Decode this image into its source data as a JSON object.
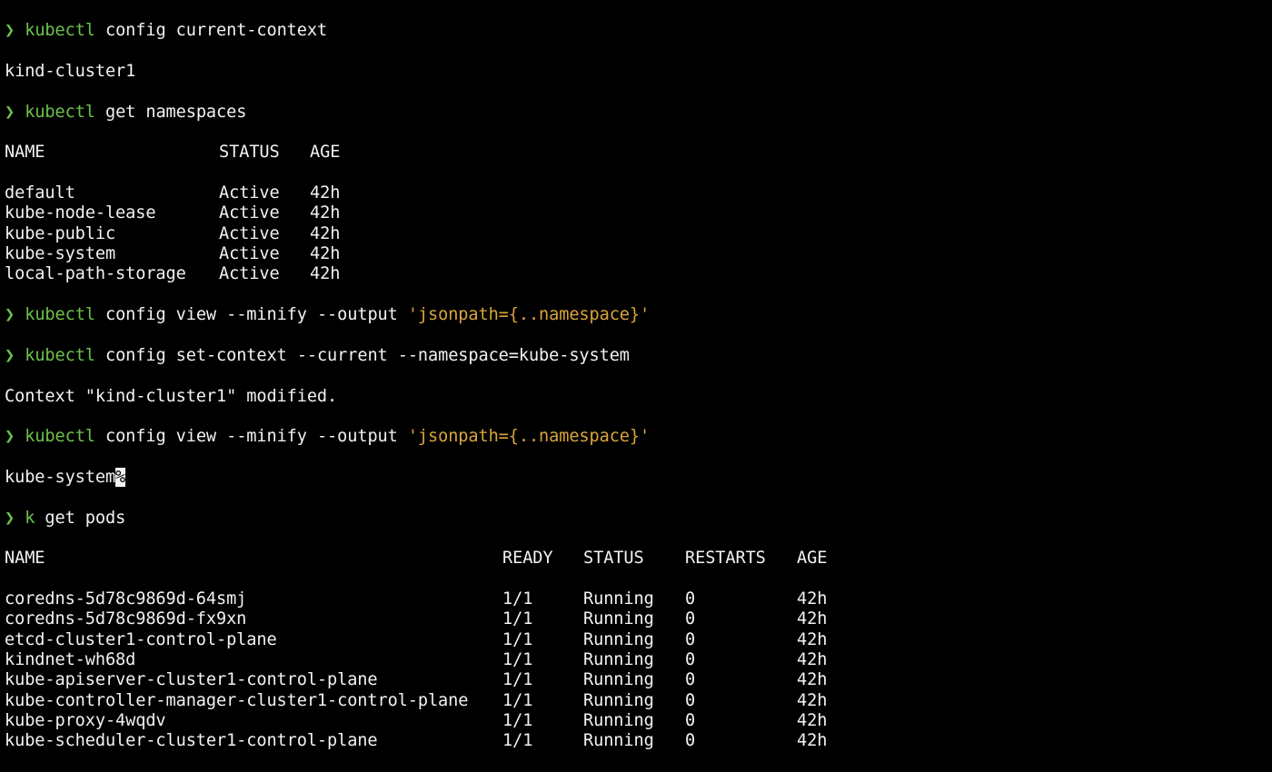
{
  "colors": {
    "background": "#000000",
    "text": "#f2f2f2",
    "command": "#6cc24a",
    "string": "#d9a53c"
  },
  "prompt_icon": "chevron-right-icon",
  "prompt_glyph": "❯",
  "lines": {
    "l1": {
      "cmd": "kubectl",
      "args": " config current-context"
    },
    "l2": "kind-cluster1",
    "l3": {
      "cmd": "kubectl",
      "args": " get namespaces"
    },
    "ns_header": {
      "name": "NAME",
      "status": "STATUS",
      "age": "AGE"
    },
    "namespaces": [
      {
        "name": "default",
        "status": "Active",
        "age": "42h"
      },
      {
        "name": "kube-node-lease",
        "status": "Active",
        "age": "42h"
      },
      {
        "name": "kube-public",
        "status": "Active",
        "age": "42h"
      },
      {
        "name": "kube-system",
        "status": "Active",
        "age": "42h"
      },
      {
        "name": "local-path-storage",
        "status": "Active",
        "age": "42h"
      }
    ],
    "l10": {
      "cmd": "kubectl",
      "args": " config view --minify --output ",
      "str": "'jsonpath={..namespace}'"
    },
    "l11": {
      "cmd": "kubectl",
      "args": " config set-context --current --namespace=kube-system"
    },
    "l12": "Context \"kind-cluster1\" modified.",
    "l13": {
      "cmd": "kubectl",
      "args": " config view --minify --output ",
      "str": "'jsonpath={..namespace}'"
    },
    "l14": {
      "text": "kube-system",
      "cursor": "%"
    },
    "l15": {
      "cmd": "k",
      "args": " get pods"
    },
    "pods_header": {
      "name": "NAME",
      "ready": "READY",
      "status": "STATUS",
      "restarts": "RESTARTS",
      "age": "AGE"
    },
    "pods": [
      {
        "name": "coredns-5d78c9869d-64smj",
        "ready": "1/1",
        "status": "Running",
        "restarts": "0",
        "age": "42h"
      },
      {
        "name": "coredns-5d78c9869d-fx9xn",
        "ready": "1/1",
        "status": "Running",
        "restarts": "0",
        "age": "42h"
      },
      {
        "name": "etcd-cluster1-control-plane",
        "ready": "1/1",
        "status": "Running",
        "restarts": "0",
        "age": "42h"
      },
      {
        "name": "kindnet-wh68d",
        "ready": "1/1",
        "status": "Running",
        "restarts": "0",
        "age": "42h"
      },
      {
        "name": "kube-apiserver-cluster1-control-plane",
        "ready": "1/1",
        "status": "Running",
        "restarts": "0",
        "age": "42h"
      },
      {
        "name": "kube-controller-manager-cluster1-control-plane",
        "ready": "1/1",
        "status": "Running",
        "restarts": "0",
        "age": "42h"
      },
      {
        "name": "kube-proxy-4wqdv",
        "ready": "1/1",
        "status": "Running",
        "restarts": "0",
        "age": "42h"
      },
      {
        "name": "kube-scheduler-cluster1-control-plane",
        "ready": "1/1",
        "status": "Running",
        "restarts": "0",
        "age": "42h"
      }
    ]
  }
}
